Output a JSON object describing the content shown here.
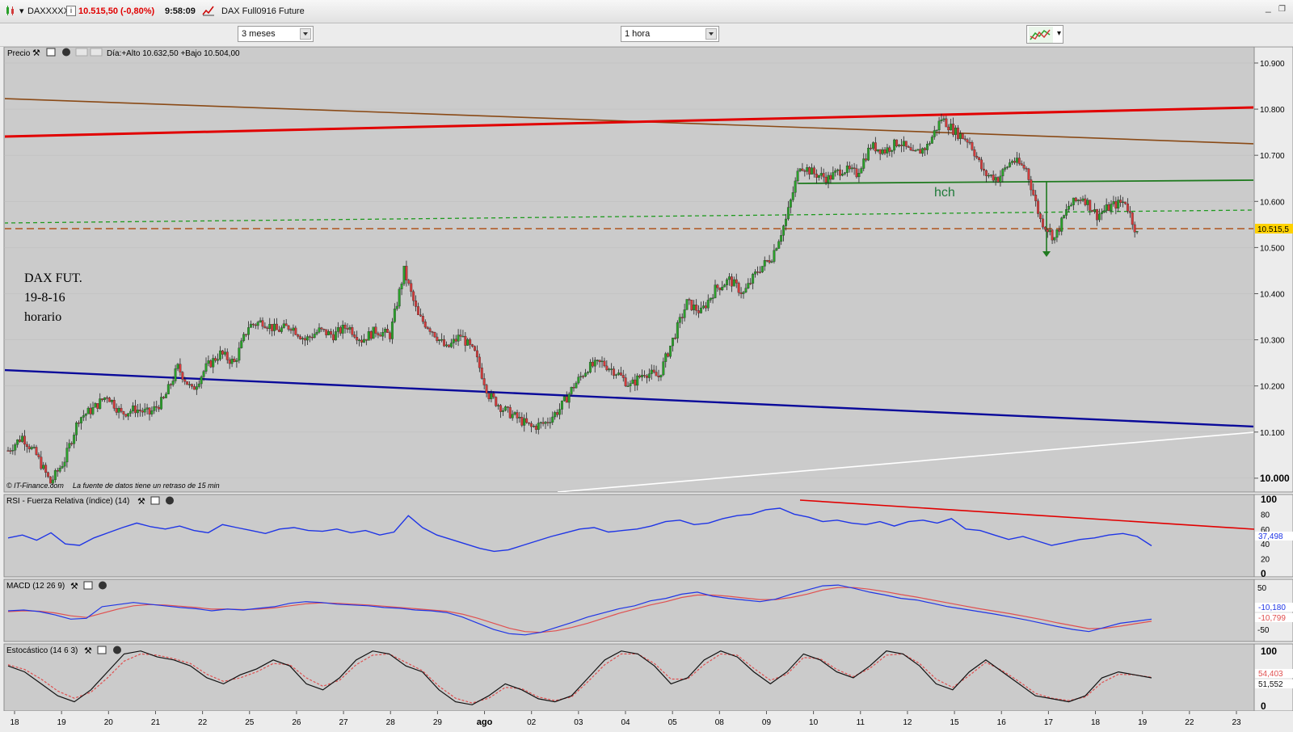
{
  "window": {
    "symbol": "DAXXXXX",
    "price_change": "10.515,50 (-0,80%)",
    "time": "9:58:09",
    "instrument": "DAX Full0916 Future",
    "minimize": "_",
    "restore": "❐"
  },
  "toolbar": {
    "period": "3 meses",
    "interval": "1 hora"
  },
  "price_panel": {
    "title": "Precio",
    "info": "Día:+Alto 10.632,50 +Bajo 10.504,00",
    "y_labels": [
      "10.900",
      "10.800",
      "10.700",
      "10.600",
      "10.500",
      "10.400",
      "10.300",
      "10.200",
      "10.100",
      "10.000"
    ],
    "current_price": "10.515,5",
    "annotation": [
      "DAX FUT.",
      "19-8-16",
      "horario"
    ],
    "pattern_label": "hch",
    "copyright": "© IT-Finance.com",
    "delay_note": "La fuente de datos tiene un retraso de 15 min"
  },
  "rsi_panel": {
    "title": "RSI - Fuerza Relativa (índice) (14)",
    "y_labels": [
      "100",
      "80",
      "60",
      "40",
      "20",
      "0"
    ],
    "value": "37,498"
  },
  "macd_panel": {
    "title": "MACD (12 26 9)",
    "y_labels": [
      "50",
      "-50"
    ],
    "value1": "-10,180",
    "value2": "-10,799"
  },
  "stoch_panel": {
    "title": "Estocástico (14 6 3)",
    "y_labels": [
      "100",
      "0"
    ],
    "value1": "54,403",
    "value2": "51,552"
  },
  "x_axis": {
    "labels": [
      "18",
      "19",
      "20",
      "21",
      "22",
      "25",
      "26",
      "27",
      "28",
      "29",
      "ago",
      "02",
      "03",
      "04",
      "05",
      "08",
      "09",
      "10",
      "11",
      "12",
      "15",
      "16",
      "17",
      "18",
      "19",
      "22",
      "23"
    ]
  },
  "colors": {
    "chart_bg": "#cbcbcb",
    "resistance_red": "#e10000",
    "trendline_brown": "#8a4a16",
    "support_blue": "#0a0a9a",
    "neckline_green": "#1f7a1f",
    "level_orange": "#b0541d",
    "rsi_blue": "#1f35e6",
    "up_candle": "#2aa02a",
    "down_candle": "#d23b3b"
  },
  "chart_data": [
    {
      "type": "candlestick",
      "title": "DAX FUT.",
      "ylim": [
        9970,
        10935
      ],
      "x_categories": [
        "18",
        "19",
        "20",
        "21",
        "22",
        "25",
        "26",
        "27",
        "28",
        "29",
        "ago",
        "02",
        "03",
        "04",
        "05",
        "08",
        "09",
        "10",
        "11",
        "12",
        "15",
        "16",
        "17",
        "18",
        "19"
      ],
      "approx_hourly_closes": [
        10060,
        10090,
        10050,
        9990,
        10040,
        10130,
        10150,
        10180,
        10140,
        10150,
        10140,
        10170,
        10240,
        10190,
        10240,
        10270,
        10250,
        10330,
        10340,
        10320,
        10330,
        10300,
        10320,
        10310,
        10330,
        10300,
        10320,
        10310,
        10450,
        10350,
        10320,
        10280,
        10310,
        10270,
        10180,
        10150,
        10130,
        10110,
        10120,
        10150,
        10200,
        10240,
        10250,
        10230,
        10200,
        10230,
        10220,
        10300,
        10380,
        10360,
        10410,
        10430,
        10400,
        10450,
        10480,
        10560,
        10680,
        10660,
        10650,
        10670,
        10660,
        10720,
        10710,
        10730,
        10700,
        10720,
        10780,
        10750,
        10730,
        10660,
        10650,
        10690,
        10670,
        10560,
        10520,
        10590,
        10610,
        10570,
        10590,
        10600,
        10515
      ],
      "levels": [
        {
          "name": "resistance",
          "from": 10735,
          "to": 10795
        },
        {
          "name": "trendline",
          "from": 10820,
          "to": 10715
        },
        {
          "name": "support",
          "from": 10205,
          "to": 10075
        },
        {
          "name": "neckline",
          "value": 10630
        },
        {
          "name": "dashed",
          "value": 10565
        },
        {
          "name": "dashed",
          "value": 10520
        }
      ]
    },
    {
      "type": "line",
      "title": "RSI",
      "ylim": [
        0,
        100
      ],
      "last": 37.498,
      "values": [
        48,
        52,
        45,
        55,
        40,
        38,
        48,
        55,
        62,
        68,
        63,
        60,
        64,
        58,
        55,
        66,
        62,
        58,
        54,
        60,
        62,
        58,
        57,
        60,
        55,
        58,
        52,
        56,
        78,
        62,
        52,
        46,
        40,
        34,
        30,
        32,
        38,
        44,
        50,
        55,
        60,
        62,
        56,
        58,
        60,
        64,
        70,
        72,
        66,
        68,
        74,
        78,
        80,
        86,
        88,
        80,
        76,
        70,
        72,
        68,
        66,
        70,
        64,
        70,
        72,
        68,
        74,
        60,
        58,
        52,
        46,
        50,
        44,
        38,
        42,
        46,
        48,
        52,
        54,
        50,
        37.5
      ]
    },
    {
      "type": "line",
      "title": "MACD",
      "ylim": [
        -60,
        80
      ],
      "series": [
        {
          "name": "MACD",
          "last": -10.18,
          "values": [
            10,
            12,
            8,
            0,
            -10,
            -8,
            20,
            25,
            30,
            26,
            22,
            18,
            15,
            10,
            14,
            12,
            16,
            20,
            28,
            32,
            30,
            26,
            24,
            22,
            18,
            16,
            12,
            10,
            6,
            -5,
            -20,
            -35,
            -45,
            -48,
            -42,
            -30,
            -18,
            -5,
            5,
            15,
            22,
            34,
            40,
            50,
            55,
            45,
            40,
            36,
            32,
            38,
            50,
            60,
            70,
            72,
            64,
            55,
            48,
            40,
            36,
            28,
            20,
            14,
            8,
            2,
            -5,
            -12,
            -20,
            -28,
            -35,
            -40,
            -30,
            -20,
            -15,
            -10
          ]
        },
        {
          "name": "Signal",
          "last": -10.799,
          "values": [
            8,
            10,
            9,
            5,
            -2,
            -6,
            4,
            14,
            22,
            25,
            24,
            21,
            18,
            14,
            14,
            13,
            14,
            17,
            22,
            27,
            29,
            28,
            26,
            24,
            21,
            18,
            15,
            12,
            9,
            2,
            -8,
            -20,
            -32,
            -40,
            -42,
            -38,
            -30,
            -20,
            -8,
            4,
            14,
            24,
            32,
            42,
            48,
            48,
            45,
            41,
            37,
            37,
            42,
            50,
            60,
            66,
            66,
            62,
            56,
            49,
            43,
            36,
            29,
            22,
            15,
            9,
            3,
            -4,
            -11,
            -19,
            -26,
            -33,
            -32,
            -27,
            -21,
            -15
          ]
        }
      ]
    },
    {
      "type": "line",
      "title": "Estocástico",
      "ylim": [
        0,
        100
      ],
      "series": [
        {
          "name": "%K",
          "last": 54.403,
          "values": [
            70,
            60,
            40,
            20,
            10,
            30,
            60,
            90,
            95,
            85,
            80,
            70,
            50,
            40,
            55,
            65,
            80,
            70,
            40,
            30,
            50,
            80,
            95,
            90,
            70,
            60,
            30,
            10,
            5,
            20,
            40,
            30,
            15,
            10,
            20,
            50,
            80,
            95,
            90,
            70,
            40,
            50,
            80,
            95,
            85,
            60,
            40,
            60,
            90,
            80,
            60,
            50,
            70,
            95,
            90,
            70,
            40,
            30,
            60,
            80,
            60,
            40,
            20,
            15,
            10,
            20,
            50,
            60,
            55,
            50
          ]
        },
        {
          "name": "%D",
          "last": 51.552,
          "values": [
            72,
            64,
            48,
            28,
            16,
            26,
            50,
            78,
            90,
            88,
            82,
            74,
            56,
            44,
            50,
            60,
            74,
            72,
            50,
            36,
            46,
            72,
            88,
            90,
            76,
            62,
            36,
            16,
            8,
            16,
            34,
            32,
            18,
            12,
            18,
            44,
            72,
            90,
            90,
            74,
            48,
            48,
            72,
            90,
            88,
            66,
            46,
            56,
            84,
            82,
            64,
            52,
            66,
            88,
            90,
            74,
            48,
            34,
            54,
            76,
            62,
            44,
            24,
            16,
            12,
            18,
            42,
            56,
            55,
            51
          ]
        }
      ]
    }
  ]
}
